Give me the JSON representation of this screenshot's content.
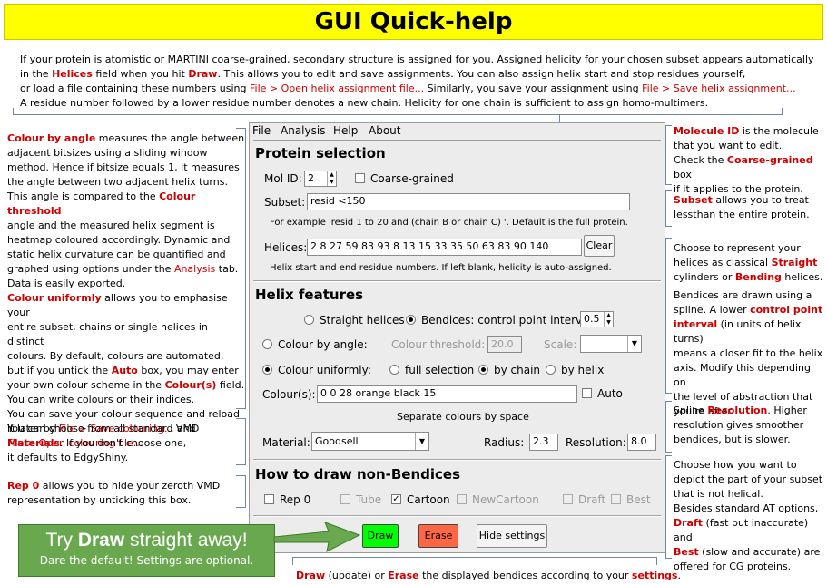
{
  "title": "GUI Quick-help",
  "intro": {
    "l1a": "If your protein is atomistic  or MARTINI  coarse-grained, secondary structure is assigned for you. Assigned helicity for your chosen subset appears automatically",
    "l2a": "in the ",
    "l2b": "Helices",
    "l2c": " field when you hit ",
    "l2d": "Draw",
    "l2e": ". This allows you to edit and save assignments.  You can also assign helix start and stop residues yourself,",
    "l3a": "or load a file containing these numbers using  ",
    "l3b": "File > Open helix assignment file...",
    "l3c": "  Similarly,  you save your assignment  using  ",
    "l3d": "File > Save helix assignment...",
    "l4": "A residue number followed by a lower residue number denotes a new chain. Helicity for one chain is sufficient to assign homo-multimers."
  },
  "left_notes": {
    "angle_a": "Colour by angle",
    "angle_b": " measures the angle between",
    "angle_l2": "adjacent bitsizes using a sliding window",
    "angle_l3": "method. Hence if bitsize equals 1, it measures",
    "angle_l4": "the angle between two adjacent helix turns.",
    "angle_l5a": "This angle is compared to the ",
    "angle_l5b": "Colour threshold",
    "angle_l6": "angle and the measured helix segment is",
    "angle_l7": "heatmap coloured accordingly. Dynamic and",
    "angle_l8": "static helix curvature can be quantified and",
    "angle_l9a": "graphed using options under the ",
    "angle_l9b": "Analysis",
    "angle_l9c": " tab.",
    "angle_l10": "Data is easily exported.",
    "unif_a": "Colour uniformly",
    "unif_b": "  allows you to emphasise your",
    "unif_l2": "entire subset, chains or single helices in distinct",
    "unif_l3": "colours. By default,  colours are automated,",
    "unif_l4a": "but if you untick the ",
    "unif_l4b": "Auto",
    "unif_l4c": " box, you may enter",
    "unif_l5a": "your own colour scheme in the ",
    "unif_l5b": "Colour(s)",
    "unif_l5c": " field.",
    "unif_l6": "You can write  colours or their indices.",
    "unif_l7": "You can save  your colour sequence and reload",
    "unif_l8a": "it later by ",
    "unif_l8b": "File >  Save colouring...",
    "unif_l8c": "   and",
    "unif_l9": "File > Open colouring file...",
    "mat_l1": "You can choose from all standard VMD",
    "mat_l2a": "Materials",
    "mat_l2b": ". If you don't choose one,",
    "mat_l3": "it defaults to EdgyShiny.",
    "rep_a": "Rep 0",
    "rep_b": " allows you to hide your zeroth VMD",
    "rep_l2": "representation by unticking this box."
  },
  "right_notes": {
    "mol_a": "Molecule ID",
    "mol_b": " is the molecule",
    "mol_l2": "that you want to edit.",
    "mol_l3a": "Check the ",
    "mol_l3b": "Coarse-grained",
    "mol_l3c": " box",
    "mol_l4": "if it applies to the protein.",
    "sub_a": "Subset",
    "sub_b": " allows you to treat",
    "sub_l2": "lessthan the entire protein.",
    "hel_l1": "Choose to represent your",
    "hel_l2a": "helices as classical ",
    "hel_l2b": "Straight",
    "hel_l3a": "cylinders or ",
    "hel_l3b": "Bending",
    "hel_l3c": " helices.",
    "bend_l1": "Bendices are drawn using a",
    "bend_l2a": "spline.  A lower ",
    "bend_l2b": "control point",
    "bend_l3a": "interval",
    "bend_l3b": " (in units of helix turns)",
    "bend_l4": "means a closer fit to the helix",
    "bend_l5": "axis. Modify this depending on",
    "bend_l6": "the level of abstraction  that",
    "bend_l7": "you're after.",
    "spl_l1a": "Spline ",
    "spl_l1b": "Resolution",
    "spl_l1c": ".  Higher",
    "spl_l2": "resolution gives smoother",
    "spl_l3": "bendices, but is slower.",
    "nb_l1": "Choose how you want to",
    "nb_l2": "depict the part of your subset",
    "nb_l3": "that is not helical.",
    "nb_l4": "Besides standard AT options,",
    "nb_l5a": "Draft",
    "nb_l5b": " (fast but inaccurate) and",
    "nb_l6a": "Best",
    "nb_l6b": " (slow and accurate) are",
    "nb_l7": "offered for CG proteins."
  },
  "bottom_note": {
    "a": "Draw",
    "b": " (update) or ",
    "c": "Erase",
    "d": " the displayed bendices according to your ",
    "e": "settings",
    "f": "."
  },
  "try_box": {
    "a": "Try ",
    "b": "Draw",
    "c": " straight away!",
    "sub": "Dare the default! Settings are optional."
  },
  "gui": {
    "menu": [
      "File",
      "Analysis",
      "Help",
      "About"
    ],
    "protein_selection": "Protein selection",
    "mol_id_label": "Mol ID:",
    "mol_id_value": "2",
    "coarse_grained": "Coarse-grained",
    "subset_label": "Subset:",
    "subset_value": "resid <150",
    "subset_hint": "For example 'resid 1 to 20 and (chain B or chain C) '. Default is the full protein.",
    "helices_label": "Helices:",
    "helices_value": "2 8 27 59 83 93 8 13 15 33 35 50 63 83 90 140",
    "clear": "Clear",
    "helices_hint": "Helix start and end residue numbers. If left blank, helicity is auto-assigned.",
    "helix_features": "Helix features",
    "straight_helices": "Straight helices",
    "bendices": "Bendices: control point interval",
    "interval_value": "0.5",
    "colour_by_angle": "Colour by angle:",
    "colour_threshold": "Colour threshold:",
    "threshold_value": "20.0",
    "scale": "Scale:",
    "colour_uniformly": "Colour uniformly:",
    "full_selection": "full selection",
    "by_chain": "by chain",
    "by_helix": "by helix",
    "colours_label": "Colour(s):",
    "colours_value": "0 0 28 orange black 15",
    "auto": "Auto",
    "separate_colours": "Separate colours by space",
    "material_label": "Material:",
    "material_value": "Goodsell",
    "radius_label": "Radius:",
    "radius_value": "2.3",
    "resolution_label": "Resolution:",
    "resolution_value": "8.0",
    "non_bendices": "How to draw non-Bendices",
    "rep0": "Rep 0",
    "tube": "Tube",
    "cartoon": "Cartoon",
    "newcartoon": "NewCartoon",
    "draft": "Draft",
    "best": "Best",
    "draw": "Draw",
    "erase": "Erase",
    "hide_settings": "Hide settings"
  },
  "colors": {
    "title_bg": "#ffff00",
    "red_text": "#cc0000",
    "draw_btn": "#00ff00",
    "erase_btn": "#ff6644",
    "try_box": "#6aa84f",
    "bracket": "#6d87a8"
  }
}
